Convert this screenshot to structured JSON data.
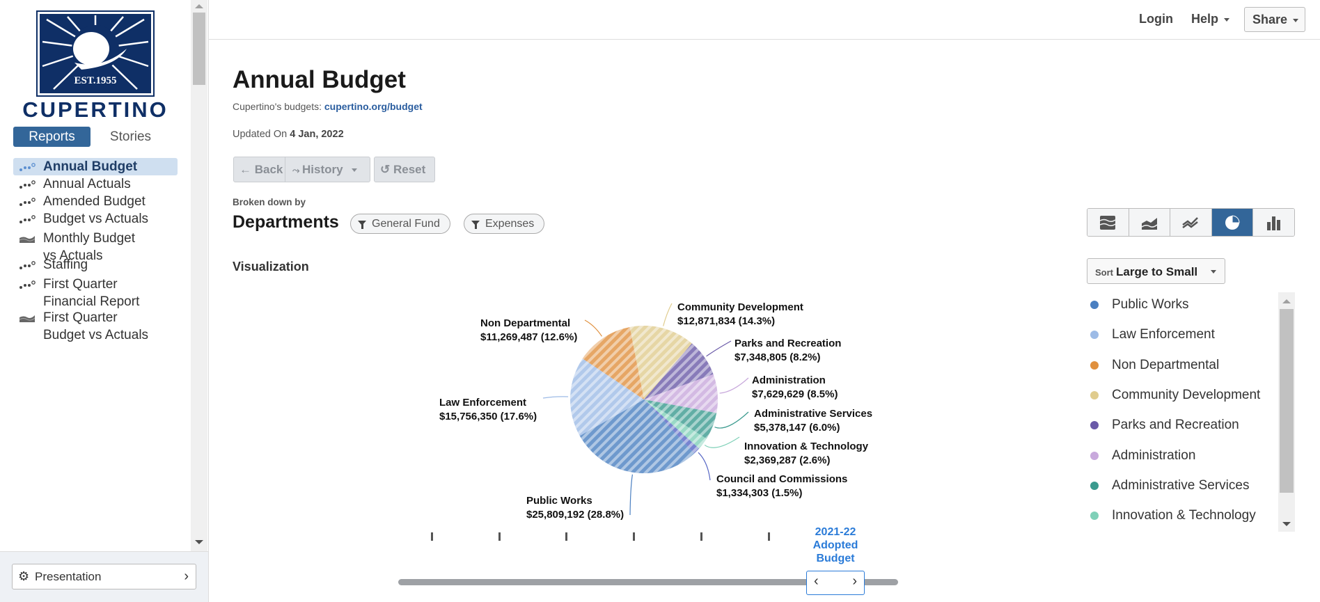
{
  "sidebar": {
    "logo": {
      "text": "CUPERTINO",
      "est": "EST.1955"
    },
    "tabs": {
      "reports": "Reports",
      "stories": "Stories"
    },
    "items": [
      {
        "label": "Annual Budget",
        "icon": "scatter-dots-icon",
        "active": true
      },
      {
        "label": "Annual Actuals",
        "icon": "scatter-dots-icon"
      },
      {
        "label": "Amended Budget",
        "icon": "scatter-dots-icon"
      },
      {
        "label": "Budget vs Actuals",
        "icon": "scatter-dots-icon"
      },
      {
        "label": "Monthly Budget vs Actuals",
        "line1": "Monthly Budget",
        "line2": "vs Actuals",
        "icon": "area-chart-icon"
      },
      {
        "label": "Staffing",
        "icon": "scatter-dots-icon"
      },
      {
        "label": "First Quarter Financial Report",
        "line1": "First Quarter",
        "line2": "Financial Report",
        "icon": "scatter-dots-icon"
      },
      {
        "label": "First Quarter Budget vs Actuals",
        "line1": "First Quarter",
        "line2": "Budget vs Actuals",
        "icon": "area-chart-icon"
      }
    ],
    "presentation": "Presentation"
  },
  "header": {
    "login": "Login",
    "help": "Help",
    "share": "Share"
  },
  "page": {
    "title": "Annual Budget",
    "subtitle_prefix": "Cupertino's budgets: ",
    "subtitle_link": "cupertino.org/budget",
    "updated_prefix": "Updated On ",
    "updated_date": "4 Jan, 2022",
    "back": "Back",
    "history": "History",
    "reset": "Reset",
    "broken_down_by": "Broken down by",
    "dimension": "Departments",
    "filters": [
      "General Fund",
      "Expenses"
    ],
    "visualization": "Visualization",
    "sort_label": "Sort",
    "sort_value": "Large to Small",
    "view_modes": [
      "stacked-area-icon",
      "area-icon",
      "line-icon",
      "pie-icon",
      "bar-icon"
    ],
    "active_view": "pie-icon",
    "period": {
      "line1": "2021-22",
      "line2": "Adopted",
      "line3": "Budget"
    },
    "accent": "#336699"
  },
  "chart_data": {
    "type": "pie",
    "slices": [
      {
        "name": "Public Works",
        "value": 25809192,
        "value_label": "$25,809,192",
        "pct": "28.8%",
        "color": "#4a7fc1"
      },
      {
        "name": "Law Enforcement",
        "value": 15756350,
        "value_label": "$15,756,350",
        "pct": "17.6%",
        "color": "#9dbbe6"
      },
      {
        "name": "Non Departmental",
        "value": 11269487,
        "value_label": "$11,269,487",
        "pct": "12.6%",
        "color": "#e0903e"
      },
      {
        "name": "Community Development",
        "value": 12871834,
        "value_label": "$12,871,834",
        "pct": "14.3%",
        "color": "#e0cc8e"
      },
      {
        "name": "Parks and Recreation",
        "value": 7348805,
        "value_label": "$7,348,805",
        "pct": "8.2%",
        "color": "#6a5aa8"
      },
      {
        "name": "Administration",
        "value": 7629629,
        "value_label": "$7,629,629",
        "pct": "8.5%",
        "color": "#c8a9dc"
      },
      {
        "name": "Administrative Services",
        "value": 5378147,
        "value_label": "$5,378,147",
        "pct": "6.0%",
        "color": "#3a9a8e"
      },
      {
        "name": "Innovation & Technology",
        "value": 2369287,
        "value_label": "$2,369,287",
        "pct": "2.6%",
        "color": "#7fd0b8"
      },
      {
        "name": "Council and Commissions",
        "value": 1334303,
        "value_label": "$1,334,303",
        "pct": "1.5%",
        "color": "#5565c4"
      }
    ],
    "legend": [
      "Public Works",
      "Law Enforcement",
      "Non Departmental",
      "Community Development",
      "Parks and Recreation",
      "Administration",
      "Administrative Services",
      "Innovation & Technology"
    ],
    "legend_placement": "right"
  }
}
